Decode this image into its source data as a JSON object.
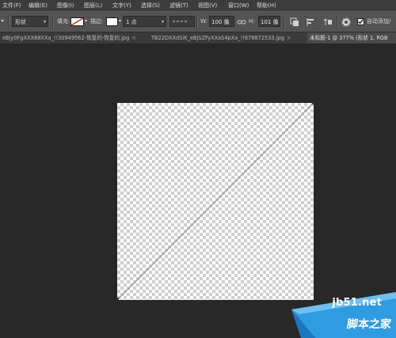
{
  "menubar": {
    "items": [
      {
        "label": "文件(F)"
      },
      {
        "label": "编辑(E)"
      },
      {
        "label": "图像(I)"
      },
      {
        "label": "图层(L)"
      },
      {
        "label": "文字(Y)"
      },
      {
        "label": "选择(S)"
      },
      {
        "label": "滤镜(T)"
      },
      {
        "label": "视图(V)"
      },
      {
        "label": "窗口(W)"
      },
      {
        "label": "帮助(H)"
      }
    ]
  },
  "options": {
    "mode_value": "形状",
    "fill_label": "填充:",
    "stroke_label": "描边:",
    "stroke_width_value": "1 点",
    "w_label": "W:",
    "w_value": "100 像",
    "h_label": "H:",
    "h_value": "101 像",
    "auto_add_label": "自动添加/"
  },
  "tabs": [
    {
      "label": "eBjy0FgXXX88XXa_!!30949562-恢复的-恢复的.jpg",
      "close": "×",
      "active": false
    },
    {
      "label": "TB22DXXdSiK_eBjSZFyXXaS4pXa_!!678872533.jpg",
      "close": "×",
      "active": false
    },
    {
      "label": "未标题-1 @ 377% (形状 1, RGB",
      "close": "",
      "active": true
    }
  ],
  "watermark": {
    "url": "jb51.net",
    "site_cn": "脚本之家"
  },
  "colors": {
    "app_bg": "#282828",
    "menubar_bg": "#3c3c3c",
    "options_bg": "#535353",
    "watermark_blue": "#2f9be0"
  }
}
